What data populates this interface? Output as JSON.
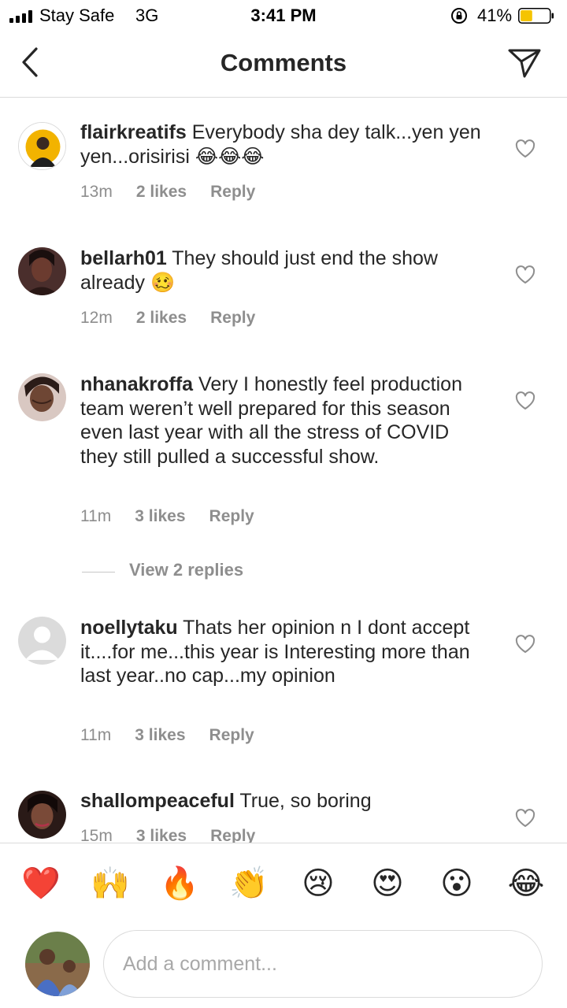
{
  "status_bar": {
    "carrier": "Stay Safe",
    "network": "3G",
    "time": "3:41 PM",
    "battery": "41%",
    "battery_level": 0.41,
    "battery_color": "#f5c400"
  },
  "header": {
    "title": "Comments",
    "back_icon": "chevron-left-icon",
    "send_icon": "paper-plane-icon"
  },
  "comments": [
    {
      "username": "flairkreatifs",
      "text": "Everybody sha dey talk...yen yen yen...orisirisi 😂😂😂",
      "time": "13m",
      "likes": "2 likes",
      "reply": "Reply"
    },
    {
      "username": "bellarh01",
      "text": "They should just end the show already 🥴",
      "time": "12m",
      "likes": "2 likes",
      "reply": "Reply"
    },
    {
      "username": "nhanakroffa",
      "text": "Very I honestly feel production team weren’t well prepared for this season even last year with all the stress of COVID they still pulled a successful show.",
      "time": "11m",
      "likes": "3 likes",
      "reply": "Reply",
      "view_replies": "View 2 replies"
    },
    {
      "username": "noellytaku",
      "text": "Thats her opinion n I dont accept it....for me...this year is Interesting more than last year..no cap...my opinion",
      "time": "11m",
      "likes": "3 likes",
      "reply": "Reply"
    },
    {
      "username": "shallompeaceful",
      "text": "True, so boring",
      "time": "15m",
      "likes": "3 likes",
      "reply": "Reply"
    }
  ],
  "emoji_bar": [
    "❤️",
    "🙌",
    "🔥",
    "👏",
    "😢",
    "😍",
    "😮",
    "😂"
  ],
  "composer": {
    "placeholder": "Add a comment..."
  },
  "colors": {
    "text": "#262626",
    "secondary": "#8e8e8e",
    "divider": "#dbdbdb"
  }
}
